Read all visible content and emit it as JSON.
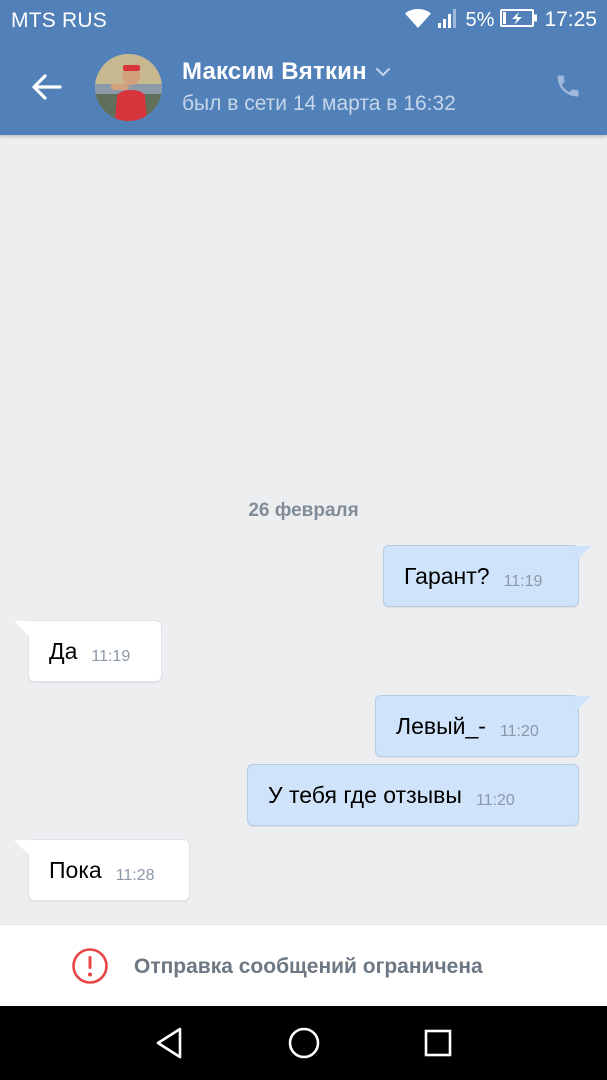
{
  "status_bar": {
    "carrier": "MTS RUS",
    "battery_percent": "5%",
    "time": "17:25",
    "icons": [
      "wifi-icon",
      "signal-icon",
      "battery-charging-icon"
    ]
  },
  "header": {
    "contact_name": "Максим Вяткин",
    "last_seen": "был в сети 14 марта в 16:32",
    "icons": [
      "back-arrow-icon",
      "chevron-down-icon",
      "phone-icon"
    ],
    "accent_color": "#5181b8"
  },
  "chat": {
    "date_separator": "26 февраля",
    "messages": [
      {
        "direction": "out",
        "text": "Гарант?",
        "time": "11:19"
      },
      {
        "direction": "in",
        "text": "Да",
        "time": "11:19"
      },
      {
        "direction": "out",
        "text": "Левый_-",
        "time": "11:20"
      },
      {
        "direction": "out",
        "text": "У тебя где отзывы",
        "time": "11:20"
      },
      {
        "direction": "in",
        "text": "Пока",
        "time": "11:28"
      }
    ],
    "colors": {
      "outgoing_bubble": "#cfe3fa",
      "incoming_bubble": "#ffffff",
      "background": "#edeef0"
    }
  },
  "composer": {
    "restriction_text": "Отправка сообщений ограничена",
    "icon": "alert-circle-icon",
    "icon_color": "#e64646"
  },
  "nav_bar": {
    "buttons": [
      "back-triangle-icon",
      "home-circle-icon",
      "recents-square-icon"
    ]
  }
}
